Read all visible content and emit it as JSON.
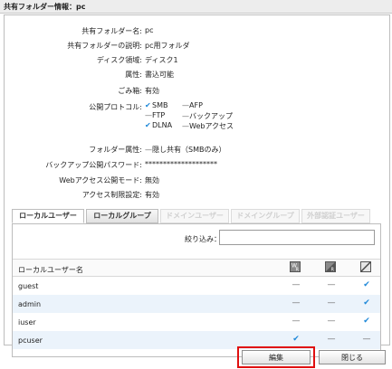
{
  "dialog": {
    "title": "共有フォルダー情報：pc"
  },
  "properties": [
    {
      "label": "共有フォルダー名:",
      "value": "pc"
    },
    {
      "label": "共有フォルダーの説明:",
      "value": "pc用フォルダ"
    },
    {
      "label": "ディスク領域:",
      "value": "ディスク1"
    },
    {
      "label": "属性:",
      "value": "書込可能"
    },
    {
      "label": "ごみ箱:",
      "value": "有効"
    }
  ],
  "protocols": {
    "label": "公開プロトコル:",
    "items": [
      {
        "name": "SMB",
        "enabled": true
      },
      {
        "name": "AFP",
        "enabled": false
      },
      {
        "name": "FTP",
        "enabled": false
      },
      {
        "name": "バックアップ",
        "enabled": false
      },
      {
        "name": "DLNA",
        "enabled": true
      },
      {
        "name": "Webアクセス",
        "enabled": false
      }
    ]
  },
  "properties2": [
    {
      "label": "フォルダー属性:",
      "value": "隠し共有（SMBのみ）"
    },
    {
      "label": "バックアップ公開パスワード:",
      "value": "********************"
    },
    {
      "label": "Webアクセス公開モード:",
      "value": "無効"
    },
    {
      "label": "アクセス制限設定:",
      "value": "有効"
    }
  ],
  "tabs": [
    {
      "label": "ローカルユーザー",
      "active": true,
      "enabled": true
    },
    {
      "label": "ローカルグループ",
      "active": false,
      "enabled": true
    },
    {
      "label": "ドメインユーザー",
      "active": false,
      "enabled": false
    },
    {
      "label": "ドメイングループ",
      "active": false,
      "enabled": false
    },
    {
      "label": "外部認証ユーザー",
      "active": false,
      "enabled": false
    }
  ],
  "filter": {
    "label": "絞り込み：",
    "value": ""
  },
  "table": {
    "name_header": "ローカルユーザー名",
    "perm_icons": [
      "read-write-permission-icon",
      "read-only-permission-icon",
      "no-access-icon"
    ],
    "rows": [
      {
        "name": "guest",
        "perm": "none"
      },
      {
        "name": "admin",
        "perm": "none"
      },
      {
        "name": "iuser",
        "perm": "none"
      },
      {
        "name": "pcuser",
        "perm": "rw"
      }
    ]
  },
  "buttons": {
    "edit": "編集",
    "close": "閉じる"
  },
  "colors": {
    "check": "#1e88d8",
    "highlight": "#e01010",
    "row_alt": "#ebf3fb"
  }
}
